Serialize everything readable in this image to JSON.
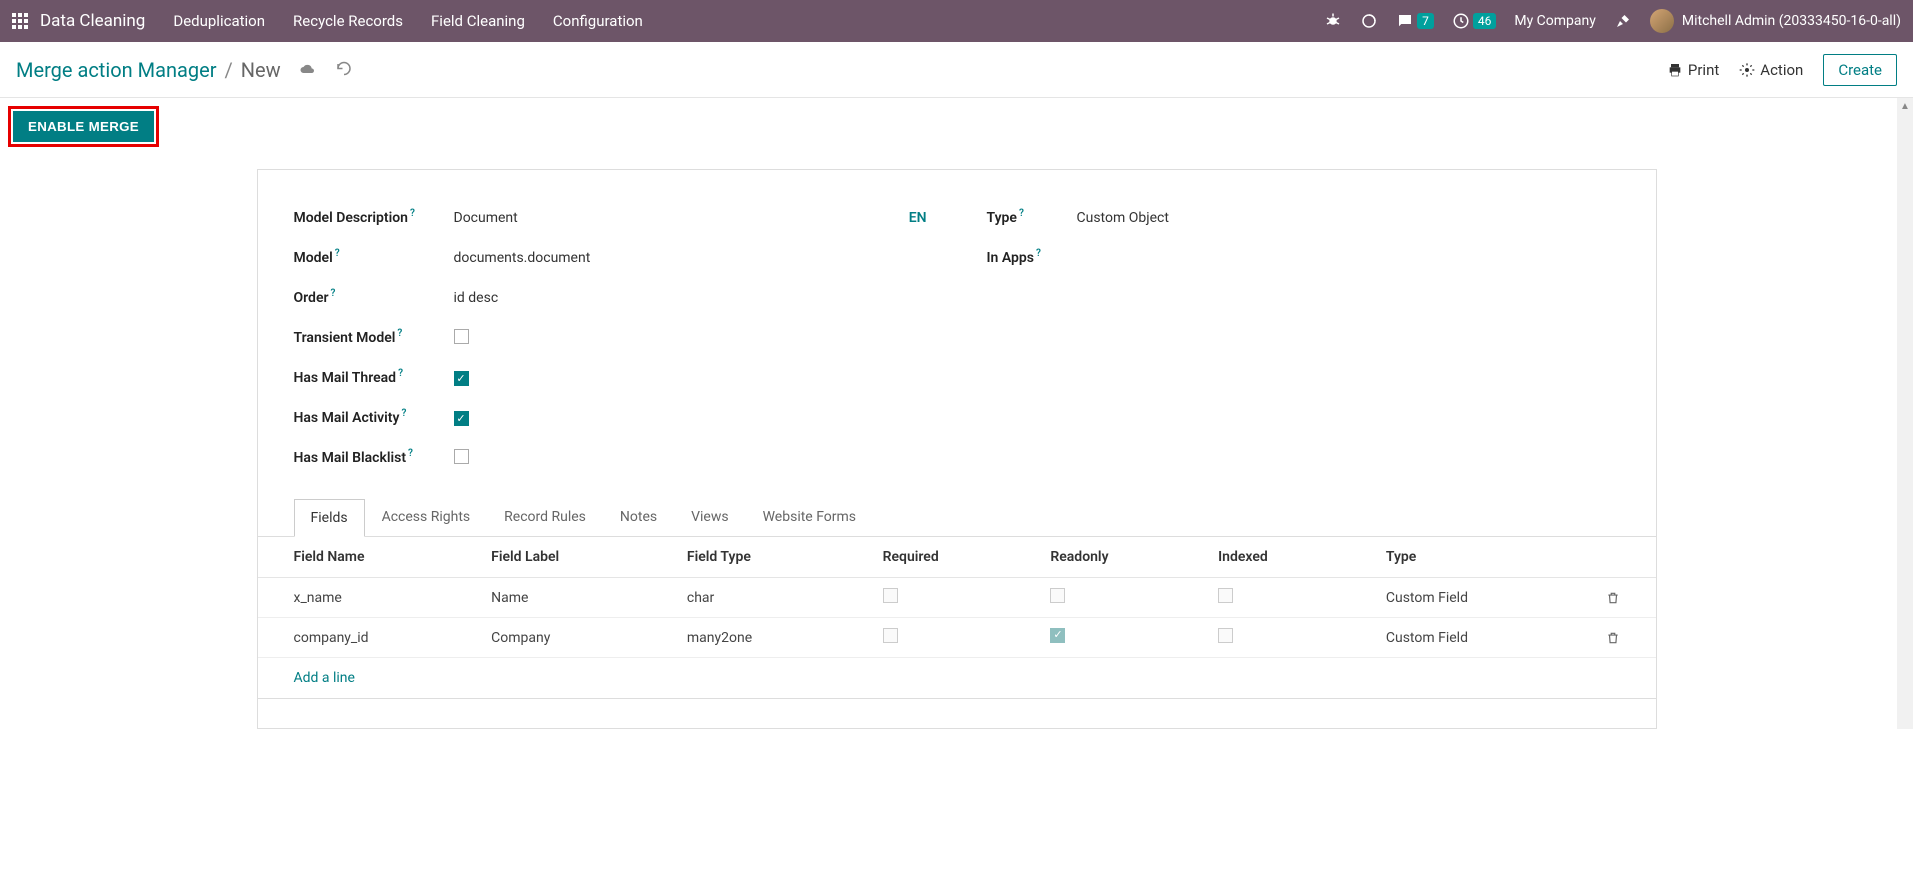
{
  "topnav": {
    "app_name": "Data Cleaning",
    "menus": [
      "Deduplication",
      "Recycle Records",
      "Field Cleaning",
      "Configuration"
    ],
    "messages_count": "7",
    "activities_count": "46",
    "company": "My Company",
    "user": "Mitchell Admin (20333450-16-0-all)"
  },
  "breadcrumb": {
    "back": "Merge action Manager",
    "current": "New",
    "print": "Print",
    "action": "Action",
    "create": "Create"
  },
  "statusbar": {
    "enable_merge": "ENABLE MERGE"
  },
  "form": {
    "left": {
      "model_description_label": "Model Description",
      "model_description_value": "Document",
      "lang": "EN",
      "model_label": "Model",
      "model_value": "documents.document",
      "order_label": "Order",
      "order_value": "id desc",
      "transient_label": "Transient Model",
      "transient_checked": false,
      "mail_thread_label": "Has Mail Thread",
      "mail_thread_checked": true,
      "mail_activity_label": "Has Mail Activity",
      "mail_activity_checked": true,
      "mail_blacklist_label": "Has Mail Blacklist",
      "mail_blacklist_checked": false
    },
    "right": {
      "type_label": "Type",
      "type_value": "Custom Object",
      "in_apps_label": "In Apps",
      "in_apps_value": ""
    }
  },
  "tabs": [
    "Fields",
    "Access Rights",
    "Record Rules",
    "Notes",
    "Views",
    "Website Forms"
  ],
  "fields_table": {
    "headers": {
      "name": "Field Name",
      "label": "Field Label",
      "type": "Field Type",
      "required": "Required",
      "readonly": "Readonly",
      "indexed": "Indexed",
      "ftype": "Type"
    },
    "rows": [
      {
        "name": "x_name",
        "label": "Name",
        "type": "char",
        "required": false,
        "readonly": false,
        "indexed": false,
        "ftype": "Custom Field"
      },
      {
        "name": "company_id",
        "label": "Company",
        "type": "many2one",
        "required": false,
        "readonly": true,
        "indexed": false,
        "ftype": "Custom Field"
      }
    ],
    "add_line": "Add a line"
  }
}
